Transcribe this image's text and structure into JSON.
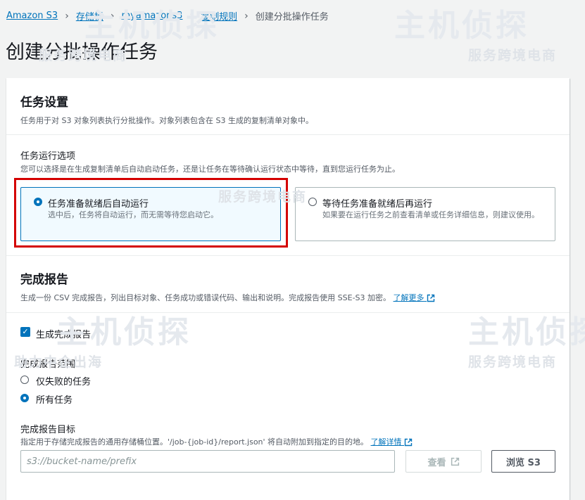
{
  "breadcrumb": {
    "items": [
      "Amazon S3",
      "存储桶",
      "myamazons3",
      "复制规则"
    ],
    "current": "创建分批操作任务"
  },
  "page_title": "创建分批操作任务",
  "task_settings": {
    "heading": "任务设置",
    "description": "任务用于对 S3 对象列表执行分批操作。对象列表包含在 S3 生成的复制清单对象中。",
    "run_options_label": "任务运行选项",
    "run_options_description": "您可以选择是在生成复制清单后自动启动任务，还是让任务在等待确认运行状态中等待，直到您运行任务为止。",
    "options": [
      {
        "title": "任务准备就绪后自动运行",
        "sub": "选中后，任务将自动运行，而无需等待您启动它。",
        "selected": true
      },
      {
        "title": "等待任务准备就绪后再运行",
        "sub": "如果要在运行任务之前查看清单或任务详细信息，则建议使用。",
        "selected": false
      }
    ]
  },
  "completion_report": {
    "heading": "完成报告",
    "description": "生成一份 CSV 完成报告，列出目标对象、任务成功或错误代码、输出和说明。完成报告使用 SSE-S3 加密。",
    "learn_more": "了解更多",
    "generate_label": "生成完成报告",
    "generate_checked": true,
    "scope_label": "完成报告范围",
    "scope_options": [
      {
        "label": "仅失败的任务",
        "selected": false
      },
      {
        "label": "所有任务",
        "selected": true
      }
    ],
    "destination_label": "完成报告目标",
    "destination_description": "指定用于存储完成报告的通用存储桶位置。'/job-{job-id}/report.json' 将自动附加到指定的目的地。",
    "learn_details": "了解详情",
    "input_placeholder": "s3://bucket-name/prefix",
    "input_value": "",
    "view_button": "查看",
    "browse_button": "浏览 S3"
  },
  "watermark": {
    "brand": "主机侦探",
    "tagline_1": "服务跨境电商",
    "tagline_2": "助力中企出海"
  },
  "colors": {
    "link": "#0073bb",
    "selected_border": "#0073bb",
    "selected_bg": "#f1faff",
    "highlight_box": "#d40000",
    "page_bg": "#f2f3f3"
  }
}
